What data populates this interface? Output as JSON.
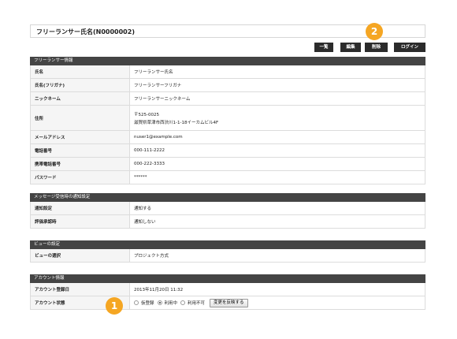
{
  "header": {
    "title": "フリーランサー氏名(N0000002)"
  },
  "toolbar": {
    "list_label": "一覧",
    "edit_label": "編集",
    "delete_label": "削除",
    "login_label": "ログイン"
  },
  "badges": {
    "one": "1",
    "two": "2"
  },
  "freelancer_info": {
    "header": "フリーランサー情報",
    "rows": [
      {
        "label": "氏名",
        "value": "フリーランサー氏名"
      },
      {
        "label": "氏名(フリガナ)",
        "value": "フリーランサーフリガナ"
      },
      {
        "label": "ニックネーム",
        "value": "フリーランサーニックネーム"
      },
      {
        "label": "住所",
        "value": "〒525-0025",
        "value2": "滋賀県草津市西渋川1-1-18イーカムビル4F"
      },
      {
        "label": "メールアドレス",
        "value": "nuser1@example.com"
      },
      {
        "label": "電話番号",
        "value": "000-111-2222"
      },
      {
        "label": "携帯電話番号",
        "value": "000-222-3333"
      },
      {
        "label": "パスワード",
        "value": "******"
      }
    ]
  },
  "notification": {
    "header": "メッセージ受信時の通知設定",
    "rows": [
      {
        "label": "通知設定",
        "value": "通知する"
      },
      {
        "label": "評価承認時",
        "value": "通知しない"
      }
    ]
  },
  "view": {
    "header": "ビューの設定",
    "rows": [
      {
        "label": "ビューの選択",
        "value": "プロジェクト方式"
      }
    ]
  },
  "account": {
    "header": "アカウント情報",
    "registered_label": "アカウント登録日",
    "registered_value": "2013年11月20日 11:32",
    "status_label": "アカウント状態",
    "status_options": [
      "仮登録",
      "利用中",
      "利用不可"
    ],
    "status_selected": "利用中",
    "apply_label": "変更を反映する"
  }
}
